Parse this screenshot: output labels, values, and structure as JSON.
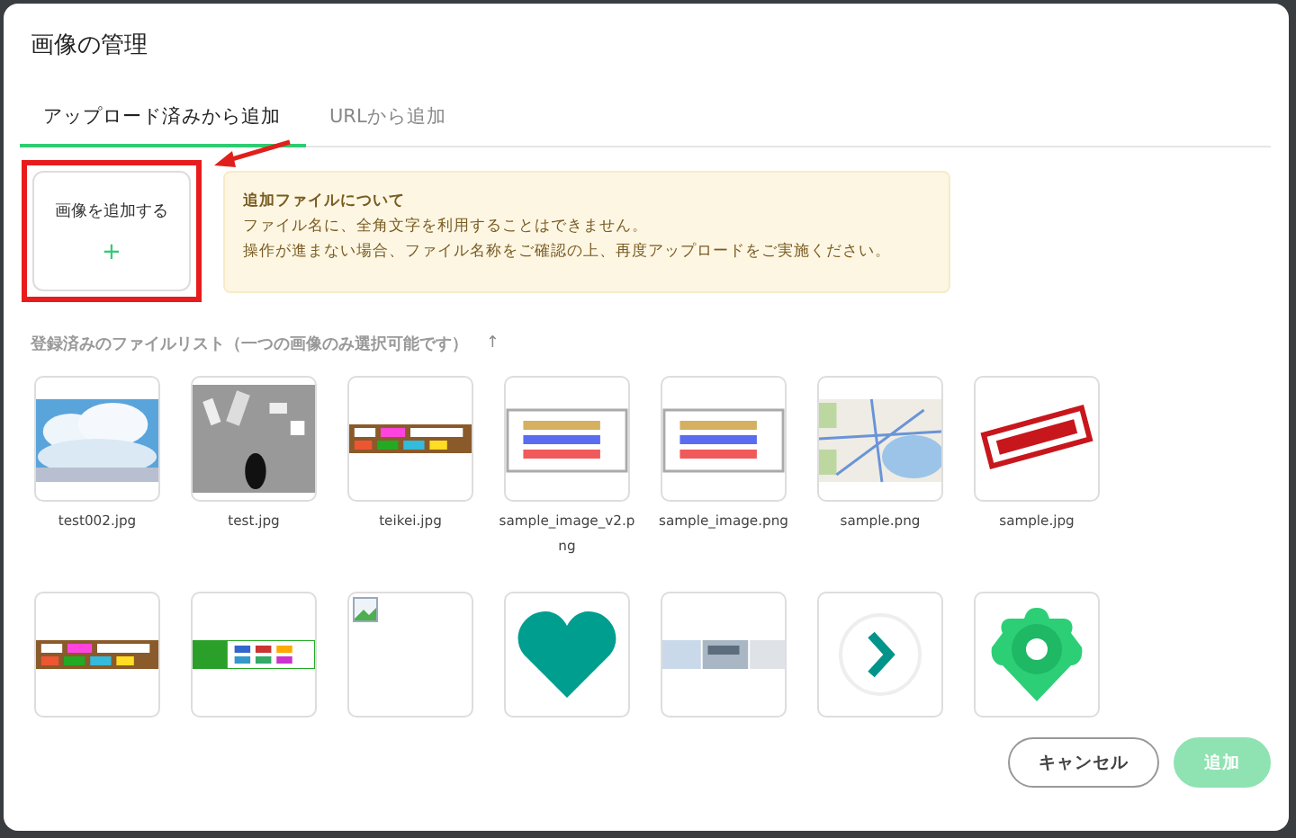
{
  "dialog": {
    "title": "画像の管理"
  },
  "tabs": [
    {
      "label": "アップロード済みから追加",
      "selected": true
    },
    {
      "label": "URLから追加",
      "selected": false
    }
  ],
  "upload": {
    "label": "画像を追加する",
    "plus": "+"
  },
  "notice": {
    "title": "追加ファイルについて",
    "lines": [
      "ファイル名に、全角文字を利用することはできません。",
      "操作が進まない場合、ファイル名称をご確認の上、再度アップロードをご実施ください。"
    ]
  },
  "list": {
    "title": "登録済みのファイルリスト（一つの画像のみ選択可能です）",
    "sort": "↑"
  },
  "files": [
    {
      "kind": "clouds",
      "caption": "test002.jpg"
    },
    {
      "kind": "sketch",
      "caption": "test.jpg"
    },
    {
      "kind": "banner",
      "caption": "teikei.jpg"
    },
    {
      "kind": "sample-text",
      "caption": "sample_image_v2.png"
    },
    {
      "kind": "sample-text",
      "caption": "sample_image.png"
    },
    {
      "kind": "map",
      "caption": "sample.png"
    },
    {
      "kind": "stamp",
      "caption": "sample.jpg"
    },
    {
      "kind": "banner"
    },
    {
      "kind": "cash-banner"
    },
    {
      "kind": "broken"
    },
    {
      "kind": "heart"
    },
    {
      "kind": "screens"
    },
    {
      "kind": "chevron"
    },
    {
      "kind": "pin"
    }
  ],
  "buttons": [
    {
      "label": "キャンセル",
      "kind": "secondary",
      "disabled": false
    },
    {
      "label": "追加",
      "kind": "primary",
      "disabled": true
    }
  ]
}
